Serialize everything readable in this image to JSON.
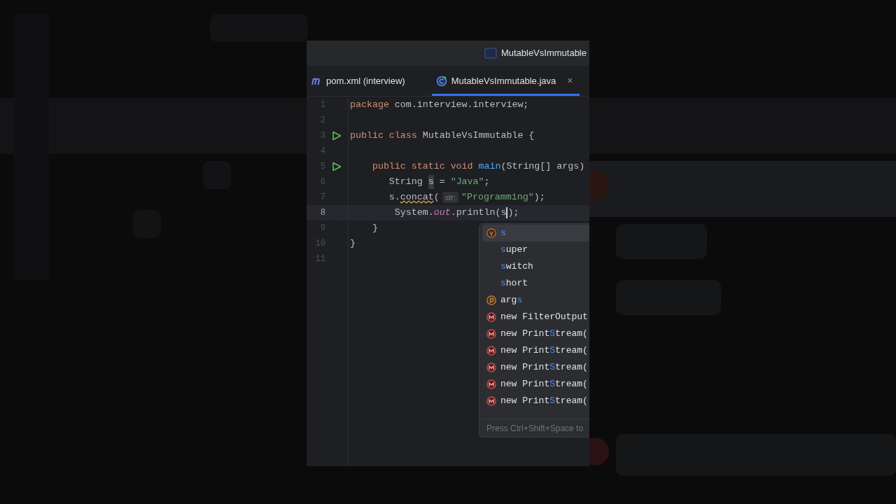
{
  "window": {
    "title": "MutableVsImmutable"
  },
  "tabs": [
    {
      "label": "pom.xml (interview)",
      "kind": "xml",
      "selected": false
    },
    {
      "label": "MutableVsImmutable.java",
      "kind": "java",
      "selected": true,
      "close": "×"
    }
  ],
  "editor": {
    "lines": [
      {
        "number": "1",
        "run": false,
        "current": false,
        "tokens": [
          {
            "text": "package",
            "kind": "kw"
          },
          {
            "text": " com.interview.interview;",
            "kind": "plain"
          }
        ]
      },
      {
        "number": "2",
        "run": false,
        "current": false
      },
      {
        "number": "3",
        "run": true,
        "current": false,
        "tokens": [
          {
            "text": "public class",
            "kind": "kw"
          },
          {
            "text": " MutableVsImmutable {",
            "kind": "plain"
          }
        ]
      },
      {
        "number": "4",
        "run": false,
        "current": false
      },
      {
        "number": "5",
        "run": true,
        "current": false,
        "tokens": [
          {
            "text": "    public static void",
            "kind": "kw"
          },
          {
            "text": " main",
            "kind": "fn"
          },
          {
            "text": "(String[] args)",
            "kind": "plain"
          }
        ]
      },
      {
        "number": "6",
        "run": false,
        "current": false,
        "tokens": [
          {
            "text": "       String ",
            "kind": "plain"
          },
          {
            "text": "s",
            "kind": "ref"
          },
          {
            "text": " = ",
            "kind": "plain"
          },
          {
            "text": "\"Java\"",
            "kind": "str"
          },
          {
            "text": ";",
            "kind": "plain"
          }
        ]
      },
      {
        "number": "7",
        "run": false,
        "current": false,
        "tokens": [
          {
            "text": "       s.",
            "kind": "plain"
          },
          {
            "text": "concat",
            "kind": "warn"
          },
          {
            "text": "(",
            "kind": "plain"
          },
          {
            "text": "str:",
            "kind": "hint"
          },
          {
            "text": "\"Programming\"",
            "kind": "str"
          },
          {
            "text": ");",
            "kind": "plain"
          }
        ]
      },
      {
        "number": "8",
        "run": false,
        "current": true,
        "tokens": [
          {
            "text": "        System.",
            "kind": "plain"
          },
          {
            "text": "out",
            "kind": "field"
          },
          {
            "text": ".println(",
            "kind": "plain"
          },
          {
            "text": "s",
            "kind": "plain",
            "caret": true
          },
          {
            "text": ");",
            "kind": "plain"
          }
        ]
      },
      {
        "number": "9",
        "run": false,
        "current": false,
        "tokens": [
          {
            "text": "    }",
            "kind": "plain"
          }
        ]
      },
      {
        "number": "10",
        "run": false,
        "current": false,
        "tokens": [
          {
            "text": "}",
            "kind": "plain"
          }
        ]
      },
      {
        "number": "11",
        "run": false,
        "current": false
      }
    ]
  },
  "completion": {
    "items": [
      {
        "kind": "variable",
        "selected": true,
        "parts": [
          {
            "text": "s",
            "hit": true
          }
        ]
      },
      {
        "kind": "keyword",
        "selected": false,
        "parts": [
          {
            "text": "s",
            "hit": true
          },
          {
            "text": "uper",
            "hit": false
          }
        ]
      },
      {
        "kind": "keyword",
        "selected": false,
        "parts": [
          {
            "text": "s",
            "hit": true
          },
          {
            "text": "witch",
            "hit": false
          }
        ]
      },
      {
        "kind": "keyword",
        "selected": false,
        "parts": [
          {
            "text": "s",
            "hit": true
          },
          {
            "text": "hort",
            "hit": false
          }
        ]
      },
      {
        "kind": "parameter",
        "selected": false,
        "parts": [
          {
            "text": "arg",
            "hit": false
          },
          {
            "text": "s",
            "hit": true
          }
        ]
      },
      {
        "kind": "method",
        "selected": false,
        "parts": [
          {
            "text": "new FilterOutput",
            "hit": false
          }
        ]
      },
      {
        "kind": "method",
        "selected": false,
        "parts": [
          {
            "text": "new Print",
            "hit": false
          },
          {
            "text": "S",
            "hit": true
          },
          {
            "text": "tream(",
            "hit": false
          }
        ]
      },
      {
        "kind": "method",
        "selected": false,
        "parts": [
          {
            "text": "new Print",
            "hit": false
          },
          {
            "text": "S",
            "hit": true
          },
          {
            "text": "tream(",
            "hit": false
          }
        ]
      },
      {
        "kind": "method",
        "selected": false,
        "parts": [
          {
            "text": "new Print",
            "hit": false
          },
          {
            "text": "S",
            "hit": true
          },
          {
            "text": "tream(",
            "hit": false
          }
        ]
      },
      {
        "kind": "method",
        "selected": false,
        "parts": [
          {
            "text": "new Print",
            "hit": false
          },
          {
            "text": "S",
            "hit": true
          },
          {
            "text": "tream(",
            "hit": false
          }
        ]
      },
      {
        "kind": "method",
        "selected": false,
        "parts": [
          {
            "text": "new Print",
            "hit": false
          },
          {
            "text": "S",
            "hit": true
          },
          {
            "text": "tream(",
            "hit": false
          }
        ]
      }
    ],
    "footer": "Press Ctrl+Shift+Space to"
  }
}
